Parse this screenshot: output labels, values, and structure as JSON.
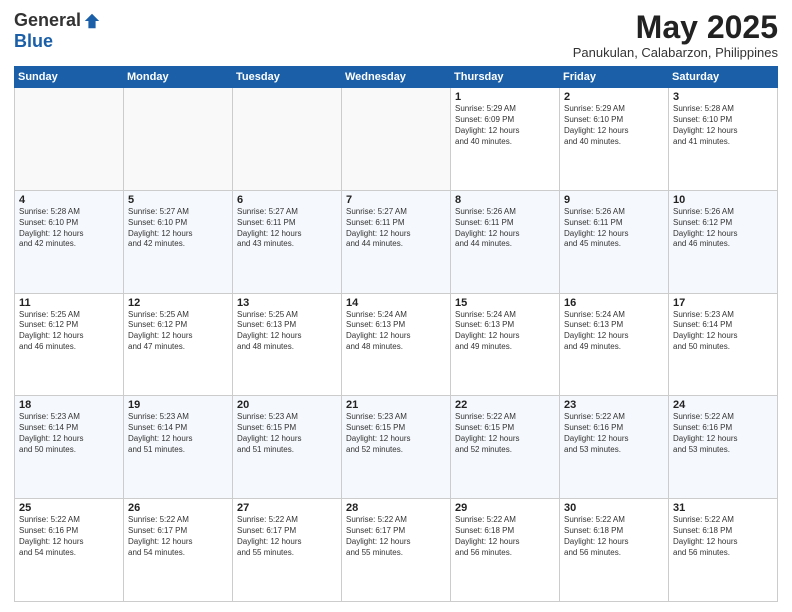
{
  "logo": {
    "general": "General",
    "blue": "Blue"
  },
  "title": "May 2025",
  "location": "Panukulan, Calabarzon, Philippines",
  "days_of_week": [
    "Sunday",
    "Monday",
    "Tuesday",
    "Wednesday",
    "Thursday",
    "Friday",
    "Saturday"
  ],
  "weeks": [
    [
      {
        "day": "",
        "info": ""
      },
      {
        "day": "",
        "info": ""
      },
      {
        "day": "",
        "info": ""
      },
      {
        "day": "",
        "info": ""
      },
      {
        "day": "1",
        "info": "Sunrise: 5:29 AM\nSunset: 6:09 PM\nDaylight: 12 hours\nand 40 minutes."
      },
      {
        "day": "2",
        "info": "Sunrise: 5:29 AM\nSunset: 6:10 PM\nDaylight: 12 hours\nand 40 minutes."
      },
      {
        "day": "3",
        "info": "Sunrise: 5:28 AM\nSunset: 6:10 PM\nDaylight: 12 hours\nand 41 minutes."
      }
    ],
    [
      {
        "day": "4",
        "info": "Sunrise: 5:28 AM\nSunset: 6:10 PM\nDaylight: 12 hours\nand 42 minutes."
      },
      {
        "day": "5",
        "info": "Sunrise: 5:27 AM\nSunset: 6:10 PM\nDaylight: 12 hours\nand 42 minutes."
      },
      {
        "day": "6",
        "info": "Sunrise: 5:27 AM\nSunset: 6:11 PM\nDaylight: 12 hours\nand 43 minutes."
      },
      {
        "day": "7",
        "info": "Sunrise: 5:27 AM\nSunset: 6:11 PM\nDaylight: 12 hours\nand 44 minutes."
      },
      {
        "day": "8",
        "info": "Sunrise: 5:26 AM\nSunset: 6:11 PM\nDaylight: 12 hours\nand 44 minutes."
      },
      {
        "day": "9",
        "info": "Sunrise: 5:26 AM\nSunset: 6:11 PM\nDaylight: 12 hours\nand 45 minutes."
      },
      {
        "day": "10",
        "info": "Sunrise: 5:26 AM\nSunset: 6:12 PM\nDaylight: 12 hours\nand 46 minutes."
      }
    ],
    [
      {
        "day": "11",
        "info": "Sunrise: 5:25 AM\nSunset: 6:12 PM\nDaylight: 12 hours\nand 46 minutes."
      },
      {
        "day": "12",
        "info": "Sunrise: 5:25 AM\nSunset: 6:12 PM\nDaylight: 12 hours\nand 47 minutes."
      },
      {
        "day": "13",
        "info": "Sunrise: 5:25 AM\nSunset: 6:13 PM\nDaylight: 12 hours\nand 48 minutes."
      },
      {
        "day": "14",
        "info": "Sunrise: 5:24 AM\nSunset: 6:13 PM\nDaylight: 12 hours\nand 48 minutes."
      },
      {
        "day": "15",
        "info": "Sunrise: 5:24 AM\nSunset: 6:13 PM\nDaylight: 12 hours\nand 49 minutes."
      },
      {
        "day": "16",
        "info": "Sunrise: 5:24 AM\nSunset: 6:13 PM\nDaylight: 12 hours\nand 49 minutes."
      },
      {
        "day": "17",
        "info": "Sunrise: 5:23 AM\nSunset: 6:14 PM\nDaylight: 12 hours\nand 50 minutes."
      }
    ],
    [
      {
        "day": "18",
        "info": "Sunrise: 5:23 AM\nSunset: 6:14 PM\nDaylight: 12 hours\nand 50 minutes."
      },
      {
        "day": "19",
        "info": "Sunrise: 5:23 AM\nSunset: 6:14 PM\nDaylight: 12 hours\nand 51 minutes."
      },
      {
        "day": "20",
        "info": "Sunrise: 5:23 AM\nSunset: 6:15 PM\nDaylight: 12 hours\nand 51 minutes."
      },
      {
        "day": "21",
        "info": "Sunrise: 5:23 AM\nSunset: 6:15 PM\nDaylight: 12 hours\nand 52 minutes."
      },
      {
        "day": "22",
        "info": "Sunrise: 5:22 AM\nSunset: 6:15 PM\nDaylight: 12 hours\nand 52 minutes."
      },
      {
        "day": "23",
        "info": "Sunrise: 5:22 AM\nSunset: 6:16 PM\nDaylight: 12 hours\nand 53 minutes."
      },
      {
        "day": "24",
        "info": "Sunrise: 5:22 AM\nSunset: 6:16 PM\nDaylight: 12 hours\nand 53 minutes."
      }
    ],
    [
      {
        "day": "25",
        "info": "Sunrise: 5:22 AM\nSunset: 6:16 PM\nDaylight: 12 hours\nand 54 minutes."
      },
      {
        "day": "26",
        "info": "Sunrise: 5:22 AM\nSunset: 6:17 PM\nDaylight: 12 hours\nand 54 minutes."
      },
      {
        "day": "27",
        "info": "Sunrise: 5:22 AM\nSunset: 6:17 PM\nDaylight: 12 hours\nand 55 minutes."
      },
      {
        "day": "28",
        "info": "Sunrise: 5:22 AM\nSunset: 6:17 PM\nDaylight: 12 hours\nand 55 minutes."
      },
      {
        "day": "29",
        "info": "Sunrise: 5:22 AM\nSunset: 6:18 PM\nDaylight: 12 hours\nand 56 minutes."
      },
      {
        "day": "30",
        "info": "Sunrise: 5:22 AM\nSunset: 6:18 PM\nDaylight: 12 hours\nand 56 minutes."
      },
      {
        "day": "31",
        "info": "Sunrise: 5:22 AM\nSunset: 6:18 PM\nDaylight: 12 hours\nand 56 minutes."
      }
    ]
  ]
}
